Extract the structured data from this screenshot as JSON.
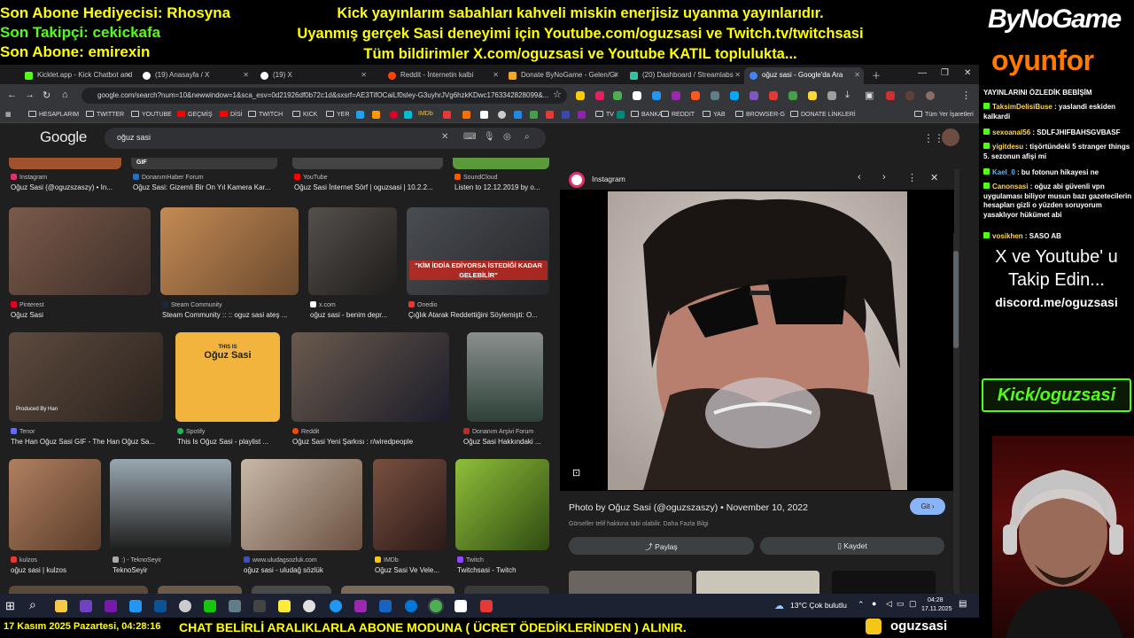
{
  "overlay": {
    "top_left": [
      {
        "text": "Son Abone Hediyecisi: Rhosyna",
        "color": "#ffff00"
      },
      {
        "text": "Son Takipçi: cekickafa",
        "color": "#53fc18"
      },
      {
        "text": "Son Abone: emirexin",
        "color": "#ffff00"
      }
    ],
    "top_center": [
      "Kick yayınlarım sabahları kahveli miskin enerjisiz uyanma yayınlarıdır.",
      "Uyanmış gerçek Sasi deneyimi için Youtube.com/oguzsasi ve Twitch.tv/twitchsasi",
      "Tüm bildirimler X.com/oguzsasi ve Youtube KATIL toplulukta..."
    ],
    "bottom_left": "17 Kasım 2025 Pazartesi, 04:28:16",
    "bottom_center": "CHAT BELİRLİ ARALIKLARLA ABONE MODUNA ( ÜCRET ÖDEDİKLERİNDEN ) ALINIR.",
    "bottom_right": "oguzsasi",
    "logo_top": "ByNoGame",
    "logo_bottom": "oyunfor",
    "promo_line1": "X ve Youtube' u",
    "promo_line2": "Takip Edin...",
    "discord": "discord.me/oguzsasi",
    "kick": "Kick/oguzsasi"
  },
  "browser": {
    "tabs": [
      {
        "label": "Kicklet.app - Kick Chatbot and",
        "color": "#53fc18"
      },
      {
        "label": "(19) Anasayfa / X",
        "color": "#ffffff"
      },
      {
        "label": "(19) X",
        "color": "#ffffff"
      },
      {
        "label": "Reddit - İnternetin kalbi",
        "color": "#ff4500"
      },
      {
        "label": "Donate ByNoGame - Gelen/Gi",
        "color": "#f5a623"
      },
      {
        "label": "(20) Dashboard / Streamlabs",
        "color": "#31c3a2"
      },
      {
        "label": "oğuz sasi - Google'da Ara",
        "color": "#4285f4"
      }
    ],
    "url": "google.com/search?num=10&newwindow=1&sca_esv=0d21926df0b72c1d&sxsrf=AE3TifOCaiLf0sley-G3uyhrJVg6hzkKDwc1763342828099&...",
    "bookmarks": [
      "HESAPLARIM",
      "TWITTER",
      "YOUTUBE",
      "GEÇMİŞ",
      "DİSİ",
      "TWITCH",
      "KICK",
      "YER",
      "IMDb",
      "TV",
      "BANKA",
      "REDDIT",
      "YAB",
      "BROWSER-G",
      "DONATE LİNKLERİ"
    ],
    "all_bookmarks": "Tüm Yer İşaretleri"
  },
  "google": {
    "logo": "Google",
    "query": "oğuz sasi",
    "results": [
      {
        "source": "Instagram",
        "title": "Oğuz Sasi (@oguzszaszy) • In...",
        "scolor": "#e1306c"
      },
      {
        "source": "DonanımHaber Forum",
        "title": "Oğuz Sasi: Gizemli Bir On Yıl Kamera Kar...",
        "scolor": "#2a6ebb"
      },
      {
        "source": "YouTube",
        "title": "Oğuz Sasi İnternet Sörf | oguzsasi | 10.2.2...",
        "scolor": "#ff0000"
      },
      {
        "source": "SoundCloud",
        "title": "Listen to 12.12.2019 by o...",
        "scolor": "#ff5500"
      },
      {
        "source": "Pinterest",
        "title": "Oğuz Sasi",
        "scolor": "#e60023"
      },
      {
        "source": "Steam Community",
        "title": "Steam Community :: :: oguz sasi ateş ...",
        "scolor": "#1b2838"
      },
      {
        "source": "x.com",
        "title": "oğuz sasi - benim depr...",
        "scolor": "#ffffff"
      },
      {
        "source": "Onedio",
        "title": "Çığlık Atarak Reddettiğini Söylemişti: O...",
        "scolor": "#e53935"
      },
      {
        "source": "Tenor",
        "title": "The Han Oğuz Sasi GIF - The Han Oğuz Sa...",
        "scolor": "#5f6dff"
      },
      {
        "source": "Spotify",
        "title": "This Is Oğuz Sasi - playlist ...",
        "scolor": "#1db954"
      },
      {
        "source": "Reddit",
        "title": "Oğuz Sasi Yeni Şarkısı : r/wiredpeople",
        "scolor": "#ff4500"
      },
      {
        "source": "Donanım Arşivi Forum",
        "title": "Oğuz Sasi Hakkındaki ...",
        "scolor": "#c62828"
      },
      {
        "source": "kulzos",
        "title": "oğuz sasi | kulzos",
        "scolor": "#e53935"
      },
      {
        "source": ":) - TeknoSeyir",
        "title": "TeknoSeyir",
        "scolor": "#aaaaaa"
      },
      {
        "source": "www.uludagsozluk.com",
        "title": "oğuz sasi - uludağ sözlük",
        "scolor": "#3f51b5"
      },
      {
        "source": "IMDb",
        "title": "Oğuz Sasi Ve Vele...",
        "scolor": "#f5c518"
      },
      {
        "source": "Twitch",
        "title": "Twitchsasi - Twitch",
        "scolor": "#9146ff"
      }
    ],
    "gif_badge": "GIF",
    "thumb_text_1": "\"KİM İDDİA EDİYORSA İSTEDİĞİ KADAR GELEBİLİR\"",
    "thumb_text_2": "THIS IS",
    "thumb_text_3": "Oğuz Sasi",
    "thumb_text_4": "Produced By Han",
    "panel": {
      "source": "Instagram",
      "caption": "Photo by Oğuz Sasi (@oguzszaszy) • November 10, 2022",
      "sub": "Görseller telif hakkına tabi olabilir. Daha Fazla Bilgi",
      "visit": "Git",
      "share": "Paylaş",
      "save": "Kaydet"
    }
  },
  "taskbar": {
    "weather": "13°C  Çok bulutlu",
    "time": "04:28",
    "date": "17.11.2025"
  },
  "chat": [
    {
      "user": "",
      "msg": "YAYINLARINI ÖZLEDİK BEBİŞİM",
      "ucolor": "#ffffff"
    },
    {
      "user": "TaksimDelisiBuse",
      "msg": ": yaslandi eskiden kalkardi",
      "ucolor": "#ffd54f"
    },
    {
      "user": "sexoanal56",
      "msg": ": SDLFJHIFBAHSGVBASF",
      "ucolor": "#ffd54f"
    },
    {
      "user": "yigitdesu",
      "msg": ": tişörtündeki 5 stranger things 5. sezonun afişi mi",
      "ucolor": "#ffd54f"
    },
    {
      "user": "Kael_0",
      "msg": ": bu fotonun hikayesi ne",
      "ucolor": "#64b5f6"
    },
    {
      "user": "Canonsasi",
      "msg": ": oğuz abi güvenli vpn uygulaması biliyor musun bazı gazetecilerin hesapları gizli o yüzden soruyorum yasaklıyor hükümet abi",
      "ucolor": "#ffd54f"
    },
    {
      "user": "vosikhen",
      "msg": ": SASO AB",
      "ucolor": "#ffd54f"
    }
  ]
}
